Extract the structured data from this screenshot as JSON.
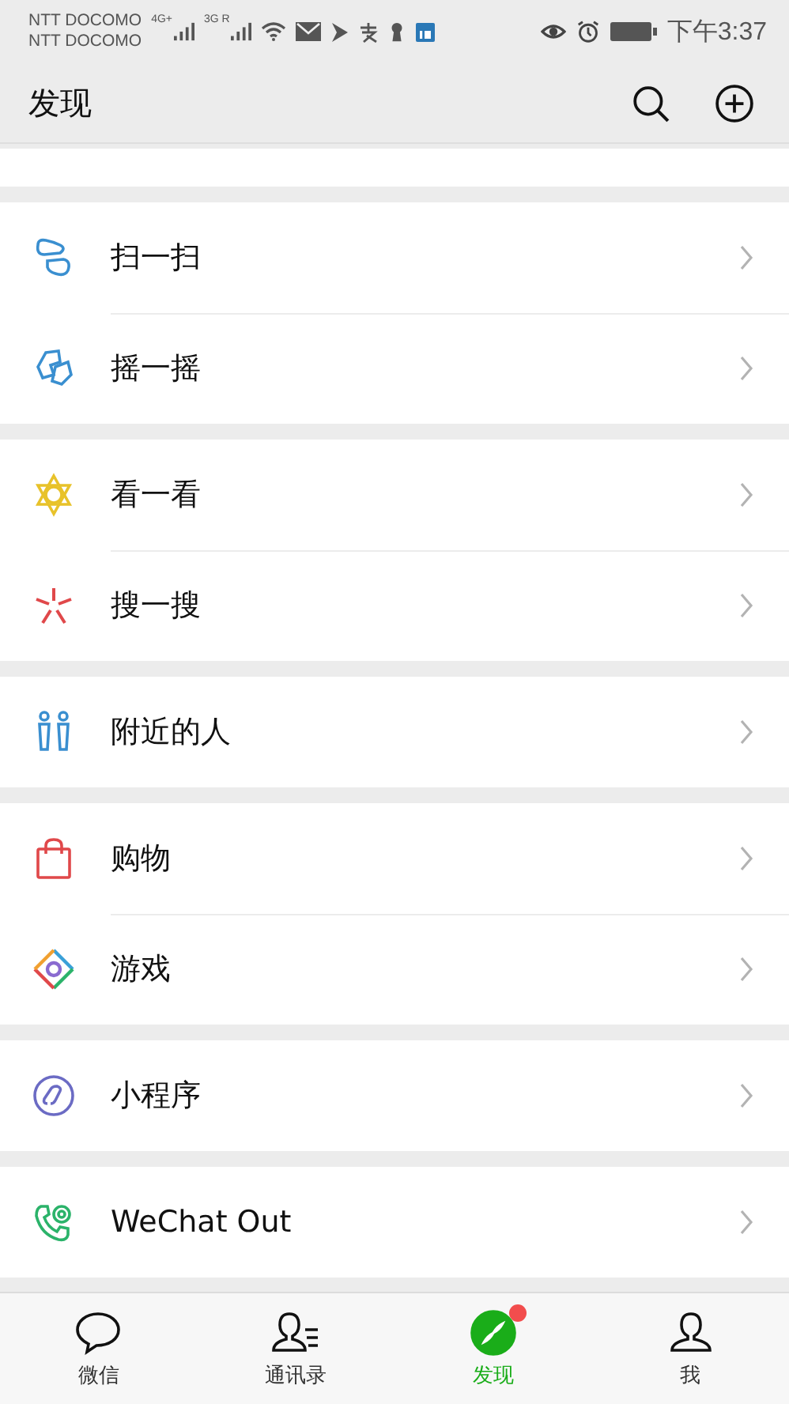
{
  "status_bar": {
    "carriers": [
      "NTT DOCOMO",
      "NTT DOCOMO"
    ],
    "network_labels": [
      "4G+",
      "3G R"
    ],
    "time": "下午3:37"
  },
  "header": {
    "title": "发现"
  },
  "groups": [
    {
      "items": [
        {
          "label": "扫一扫"
        },
        {
          "label": "摇一摇"
        }
      ]
    },
    {
      "items": [
        {
          "label": "看一看"
        },
        {
          "label": "搜一搜"
        }
      ]
    },
    {
      "items": [
        {
          "label": "附近的人"
        }
      ]
    },
    {
      "items": [
        {
          "label": "购物"
        },
        {
          "label": "游戏"
        }
      ]
    },
    {
      "items": [
        {
          "label": "小程序"
        }
      ]
    },
    {
      "items": [
        {
          "label": "WeChat Out"
        }
      ]
    }
  ],
  "tab_bar": [
    {
      "label": "微信",
      "selected": false,
      "dot": false
    },
    {
      "label": "通讯录",
      "selected": false,
      "dot": false
    },
    {
      "label": "发现",
      "selected": true,
      "dot": true
    },
    {
      "label": "我",
      "selected": false,
      "dot": false
    }
  ]
}
